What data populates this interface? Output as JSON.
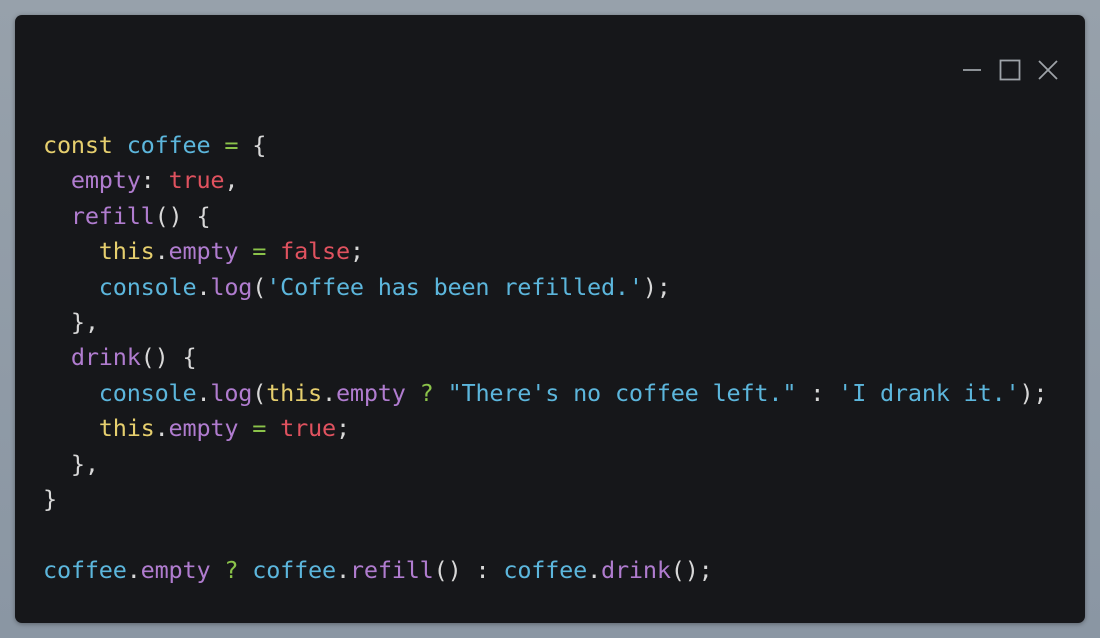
{
  "window": {
    "controls": {
      "minimize": "minimize-icon",
      "maximize": "maximize-icon",
      "close": "close-icon"
    }
  },
  "colors": {
    "background": "#16171a",
    "keyword": "#e6cf6e",
    "identifier": "#5cb6dc",
    "property": "#b07ccf",
    "literal": "#e0525f",
    "string": "#5cb6dc",
    "operator": "#8bc34a",
    "punctuation": "#d8d8d8"
  },
  "code": {
    "lines": [
      [
        {
          "t": "const",
          "c": "kw"
        },
        {
          "t": " ",
          "c": "pun"
        },
        {
          "t": "coffee",
          "c": "var"
        },
        {
          "t": " ",
          "c": "pun"
        },
        {
          "t": "=",
          "c": "op"
        },
        {
          "t": " {",
          "c": "pun"
        }
      ],
      [
        {
          "t": "  ",
          "c": "pun"
        },
        {
          "t": "empty",
          "c": "prop"
        },
        {
          "t": ": ",
          "c": "pun"
        },
        {
          "t": "true",
          "c": "lit"
        },
        {
          "t": ",",
          "c": "pun"
        }
      ],
      [
        {
          "t": "  ",
          "c": "pun"
        },
        {
          "t": "refill",
          "c": "prop"
        },
        {
          "t": "() {",
          "c": "pun"
        }
      ],
      [
        {
          "t": "    ",
          "c": "pun"
        },
        {
          "t": "this",
          "c": "this"
        },
        {
          "t": ".",
          "c": "pun"
        },
        {
          "t": "empty",
          "c": "prop"
        },
        {
          "t": " ",
          "c": "pun"
        },
        {
          "t": "=",
          "c": "op"
        },
        {
          "t": " ",
          "c": "pun"
        },
        {
          "t": "false",
          "c": "lit"
        },
        {
          "t": ";",
          "c": "pun"
        }
      ],
      [
        {
          "t": "    ",
          "c": "pun"
        },
        {
          "t": "console",
          "c": "var"
        },
        {
          "t": ".",
          "c": "pun"
        },
        {
          "t": "log",
          "c": "prop"
        },
        {
          "t": "(",
          "c": "pun"
        },
        {
          "t": "'Coffee has been refilled.'",
          "c": "str"
        },
        {
          "t": ");",
          "c": "pun"
        }
      ],
      [
        {
          "t": "  },",
          "c": "pun"
        }
      ],
      [
        {
          "t": "  ",
          "c": "pun"
        },
        {
          "t": "drink",
          "c": "prop"
        },
        {
          "t": "() {",
          "c": "pun"
        }
      ],
      [
        {
          "t": "    ",
          "c": "pun"
        },
        {
          "t": "console",
          "c": "var"
        },
        {
          "t": ".",
          "c": "pun"
        },
        {
          "t": "log",
          "c": "prop"
        },
        {
          "t": "(",
          "c": "pun"
        },
        {
          "t": "this",
          "c": "this"
        },
        {
          "t": ".",
          "c": "pun"
        },
        {
          "t": "empty",
          "c": "prop"
        },
        {
          "t": " ",
          "c": "pun"
        },
        {
          "t": "?",
          "c": "op"
        },
        {
          "t": " ",
          "c": "pun"
        },
        {
          "t": "\"There's no coffee left.\"",
          "c": "str"
        },
        {
          "t": " : ",
          "c": "pun"
        },
        {
          "t": "'I drank it.'",
          "c": "str"
        },
        {
          "t": ");",
          "c": "pun"
        }
      ],
      [
        {
          "t": "    ",
          "c": "pun"
        },
        {
          "t": "this",
          "c": "this"
        },
        {
          "t": ".",
          "c": "pun"
        },
        {
          "t": "empty",
          "c": "prop"
        },
        {
          "t": " ",
          "c": "pun"
        },
        {
          "t": "=",
          "c": "op"
        },
        {
          "t": " ",
          "c": "pun"
        },
        {
          "t": "true",
          "c": "lit"
        },
        {
          "t": ";",
          "c": "pun"
        }
      ],
      [
        {
          "t": "  },",
          "c": "pun"
        }
      ],
      [
        {
          "t": "}",
          "c": "pun"
        }
      ],
      [
        {
          "t": "",
          "c": "pun"
        }
      ],
      [
        {
          "t": "coffee",
          "c": "var"
        },
        {
          "t": ".",
          "c": "pun"
        },
        {
          "t": "empty",
          "c": "prop"
        },
        {
          "t": " ",
          "c": "pun"
        },
        {
          "t": "?",
          "c": "op"
        },
        {
          "t": " ",
          "c": "pun"
        },
        {
          "t": "coffee",
          "c": "var"
        },
        {
          "t": ".",
          "c": "pun"
        },
        {
          "t": "refill",
          "c": "prop"
        },
        {
          "t": "() : ",
          "c": "pun"
        },
        {
          "t": "coffee",
          "c": "var"
        },
        {
          "t": ".",
          "c": "pun"
        },
        {
          "t": "drink",
          "c": "prop"
        },
        {
          "t": "();",
          "c": "pun"
        }
      ]
    ]
  }
}
